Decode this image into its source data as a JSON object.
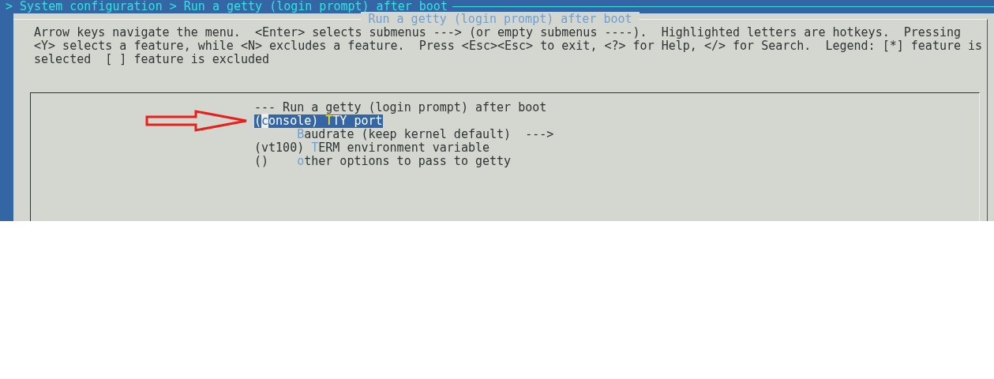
{
  "breadcrumb": "> System configuration > Run a getty (login prompt) after boot",
  "dialog": {
    "title": "Run a getty (login prompt) after boot",
    "help": "Arrow keys navigate the menu.  <Enter> selects submenus ---> (or empty submenus ----).  Highlighted letters are hotkeys.  Pressing <Y> selects a feature, while <N> excludes a feature.  Press <Esc><Esc> to exit, <?> for Help, </> for Search.  Legend: [*] feature is selected  [ ] feature is excluded",
    "menu": [
      {
        "kind": "comment",
        "label": "--- Run a getty (login prompt) after boot",
        "selected": false
      },
      {
        "kind": "string",
        "setting": "(console)",
        "label": "TTY port",
        "selected": true
      },
      {
        "kind": "submenu",
        "label": "Baudrate (keep kernel default)",
        "suffix": "--->",
        "selected": false
      },
      {
        "kind": "string",
        "setting": "(vt100)",
        "label": "TERM environment variable",
        "selected": false
      },
      {
        "kind": "string",
        "setting": "()",
        "label": "other options to pass to getty",
        "selected": false
      }
    ]
  }
}
